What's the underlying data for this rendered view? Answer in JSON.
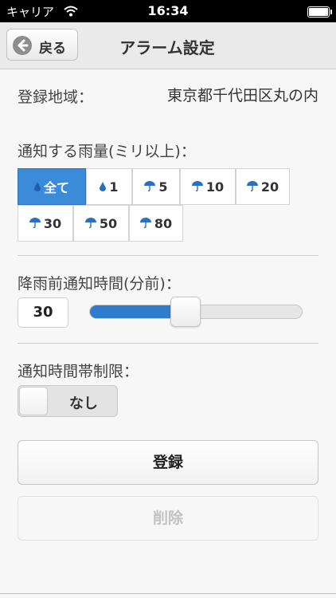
{
  "status_bar": {
    "carrier": "キャリア",
    "time": "16:34"
  },
  "nav": {
    "back_label": "戻る",
    "title": "アラーム設定"
  },
  "region": {
    "label": "登録地域：",
    "value": "東京都千代田区丸の内"
  },
  "rain": {
    "title": "通知する雨量(ミリ以上)：",
    "options": [
      {
        "label": "全て",
        "icon": "raindrop-icon",
        "selected": true
      },
      {
        "label": "1",
        "icon": "raindrop-icon",
        "selected": false
      },
      {
        "label": "5",
        "icon": "umbrella-icon",
        "selected": false
      },
      {
        "label": "10",
        "icon": "umbrella-icon",
        "selected": false
      },
      {
        "label": "20",
        "icon": "umbrella-icon",
        "selected": false
      },
      {
        "label": "30",
        "icon": "umbrella-icon",
        "selected": false
      },
      {
        "label": "50",
        "icon": "umbrella-icon",
        "selected": false
      },
      {
        "label": "80",
        "icon": "umbrella-icon",
        "selected": false
      }
    ]
  },
  "pre_notice": {
    "title": "降雨前通知時間(分前)：",
    "value": "30",
    "slider_fraction": 0.45
  },
  "time_limit": {
    "title": "通知時間帯制限：",
    "toggle_label": "なし",
    "enabled": false
  },
  "buttons": {
    "register": "登録",
    "delete": "削除"
  },
  "colors": {
    "accent": "#3c8bd8",
    "slider_fill": "#2f7ccc",
    "disabled_text": "#c2c2c2"
  }
}
